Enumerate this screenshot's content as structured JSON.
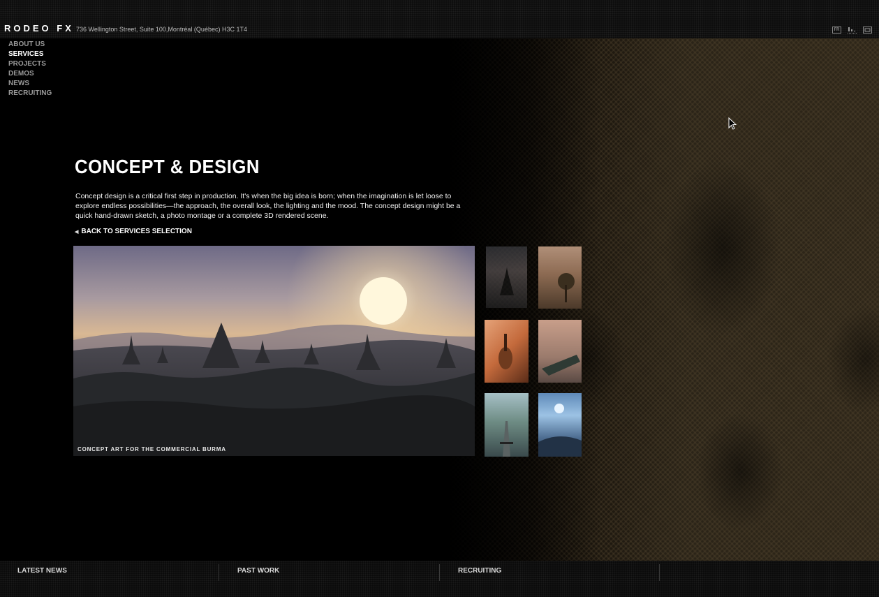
{
  "header": {
    "logo": "RODEO FX",
    "address": "736 Wellington Street, Suite 100,Montréal (Québec) H3C 1T4",
    "icons": [
      {
        "name": "language-fr-icon",
        "label": "FR"
      },
      {
        "name": "sitemap-icon",
        "label": ""
      },
      {
        "name": "fullscreen-icon",
        "label": ""
      }
    ]
  },
  "nav": {
    "items": [
      {
        "label": "ABOUT US",
        "active": false
      },
      {
        "label": "SERVICES",
        "active": true
      },
      {
        "label": "PROJECTS",
        "active": false
      },
      {
        "label": "DEMOS",
        "active": false
      },
      {
        "label": "NEWS",
        "active": false
      },
      {
        "label": "RECRUITING",
        "active": false
      }
    ]
  },
  "content": {
    "title": "CONCEPT & DESIGN",
    "description": "Concept design is a critical first step in production. It's when the big idea is born; when the imagination is let loose to explore endless possibilities—the approach, the overall look, the lighting and the mood. The concept design might be a quick hand-drawn sketch, a photo montage or a complete 3D rendered scene.",
    "back_label": "BACK TO SERVICES SELECTION",
    "main_caption": "CONCEPT ART FOR THE COMMERCIAL BURMA"
  },
  "footer": {
    "items": [
      {
        "label": "LATEST NEWS"
      },
      {
        "label": "PAST WORK"
      },
      {
        "label": "RECRUITING"
      }
    ]
  },
  "colors": {
    "background": "#000000",
    "nav_inactive": "#9a9a9a",
    "nav_active": "#ffffff"
  }
}
